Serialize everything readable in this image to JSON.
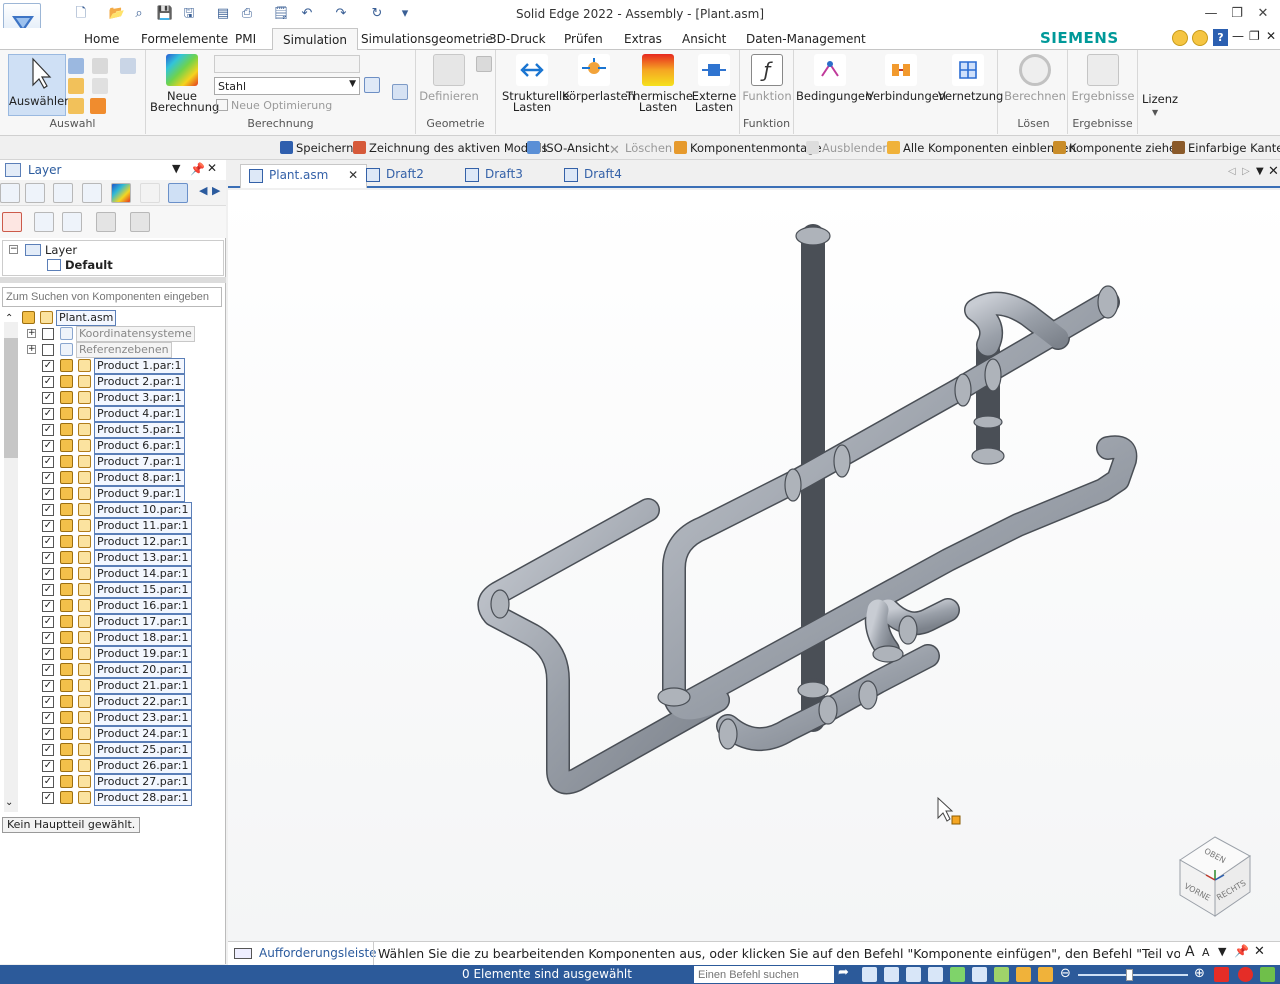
{
  "window": {
    "title": "Solid Edge 2022 - Assembly - [Plant.asm]",
    "brand": "SIEMENS"
  },
  "ribbon_tabs": [
    {
      "label": "Home"
    },
    {
      "label": "Formelemente"
    },
    {
      "label": "PMI"
    },
    {
      "label": "Simulation",
      "active": true
    },
    {
      "label": "Simulationsgeometrie"
    },
    {
      "label": "3D-Druck"
    },
    {
      "label": "Prüfen"
    },
    {
      "label": "Extras"
    },
    {
      "label": "Ansicht"
    },
    {
      "label": "Daten-Management"
    }
  ],
  "ribbon": {
    "select_group": {
      "button": "Auswählen",
      "label": "Auswahl"
    },
    "calc_group": {
      "new_calc_line1": "Neue",
      "new_calc_line2": "Berechnung",
      "material_value": "Stahl",
      "new_opt": "Neue Optimierung",
      "label": "Berechnung"
    },
    "geometry_group": {
      "button": "Definieren",
      "label": "Geometrie"
    },
    "loads": {
      "structural_line1": "Strukturelle",
      "structural_line2": "Lasten",
      "body": "Körperlasten",
      "thermal_line1": "Thermische",
      "thermal_line2": "Lasten",
      "external_line1": "Externe",
      "external_line2": "Lasten"
    },
    "function_group": {
      "button": "Funktion",
      "label": "Funktion"
    },
    "conditions": "Bedingungen",
    "connections": "Verbindungen",
    "meshing": "Vernetzung",
    "solve_group": {
      "button": "Berechnen",
      "label": "Lösen"
    },
    "results_group": {
      "button": "Ergebnisse",
      "label": "Ergebnisse"
    },
    "license": "Lizenz"
  },
  "command_bar": [
    {
      "label": "Speichern",
      "enabled": true
    },
    {
      "label": "Zeichnung des aktiven Modells",
      "enabled": true
    },
    {
      "label": "ISO-Ansicht",
      "enabled": true
    },
    {
      "label": "Löschen",
      "enabled": false
    },
    {
      "label": "Komponentenmontage",
      "enabled": true
    },
    {
      "label": "Ausblenden",
      "enabled": false
    },
    {
      "label": "Alle Komponenten einblenden",
      "enabled": true
    },
    {
      "label": "Komponente ziehen",
      "enabled": true
    },
    {
      "label": "Einfarbige Kanten",
      "enabled": true
    }
  ],
  "left_pane": {
    "title": "Layer",
    "layer_root": "Layer",
    "layer_default": "Default",
    "search_placeholder": "Zum Suchen von Komponenten eingeben",
    "tree_root": "Plant.asm",
    "tree_items": [
      {
        "label": "Koordinatensysteme",
        "checked": false
      },
      {
        "label": "Referenzebenen",
        "checked": false
      },
      {
        "label": "Product 1.par:1",
        "checked": true
      },
      {
        "label": "Product 2.par:1",
        "checked": true
      },
      {
        "label": "Product 3.par:1",
        "checked": true
      },
      {
        "label": "Product 4.par:1",
        "checked": true
      },
      {
        "label": "Product 5.par:1",
        "checked": true
      },
      {
        "label": "Product 6.par:1",
        "checked": true
      },
      {
        "label": "Product 7.par:1",
        "checked": true
      },
      {
        "label": "Product 8.par:1",
        "checked": true
      },
      {
        "label": "Product 9.par:1",
        "checked": true
      },
      {
        "label": "Product 10.par:1",
        "checked": true
      },
      {
        "label": "Product 11.par:1",
        "checked": true
      },
      {
        "label": "Product 12.par:1",
        "checked": true
      },
      {
        "label": "Product 13.par:1",
        "checked": true
      },
      {
        "label": "Product 14.par:1",
        "checked": true
      },
      {
        "label": "Product 15.par:1",
        "checked": true
      },
      {
        "label": "Product 16.par:1",
        "checked": true
      },
      {
        "label": "Product 17.par:1",
        "checked": true
      },
      {
        "label": "Product 18.par:1",
        "checked": true
      },
      {
        "label": "Product 19.par:1",
        "checked": true
      },
      {
        "label": "Product 20.par:1",
        "checked": true
      },
      {
        "label": "Product 21.par:1",
        "checked": true
      },
      {
        "label": "Product 22.par:1",
        "checked": true
      },
      {
        "label": "Product 23.par:1",
        "checked": true
      },
      {
        "label": "Product 24.par:1",
        "checked": true
      },
      {
        "label": "Product 25.par:1",
        "checked": true
      },
      {
        "label": "Product 26.par:1",
        "checked": true
      },
      {
        "label": "Product 27.par:1",
        "checked": true
      },
      {
        "label": "Product 28.par:1",
        "checked": true
      }
    ],
    "no_main_part": "Kein Hauptteil gewählt."
  },
  "doc_tabs": [
    {
      "label": "Plant.asm",
      "active": true
    },
    {
      "label": "Draft2"
    },
    {
      "label": "Draft3"
    },
    {
      "label": "Draft4"
    }
  ],
  "view_cube": {
    "top": "OBEN",
    "front": "VORNE",
    "right": "RECHTS"
  },
  "prompt": {
    "label": "Aufforderungsleiste",
    "text": "Wählen Sie die zu bearbeitenden Komponenten aus, oder klicken Sie auf den Befehl \"Komponente einfügen\", den Befehl \"Teil vor Ort"
  },
  "status": {
    "selection": "0 Elemente sind ausgewählt",
    "command_search_placeholder": "Einen Befehl suchen"
  }
}
